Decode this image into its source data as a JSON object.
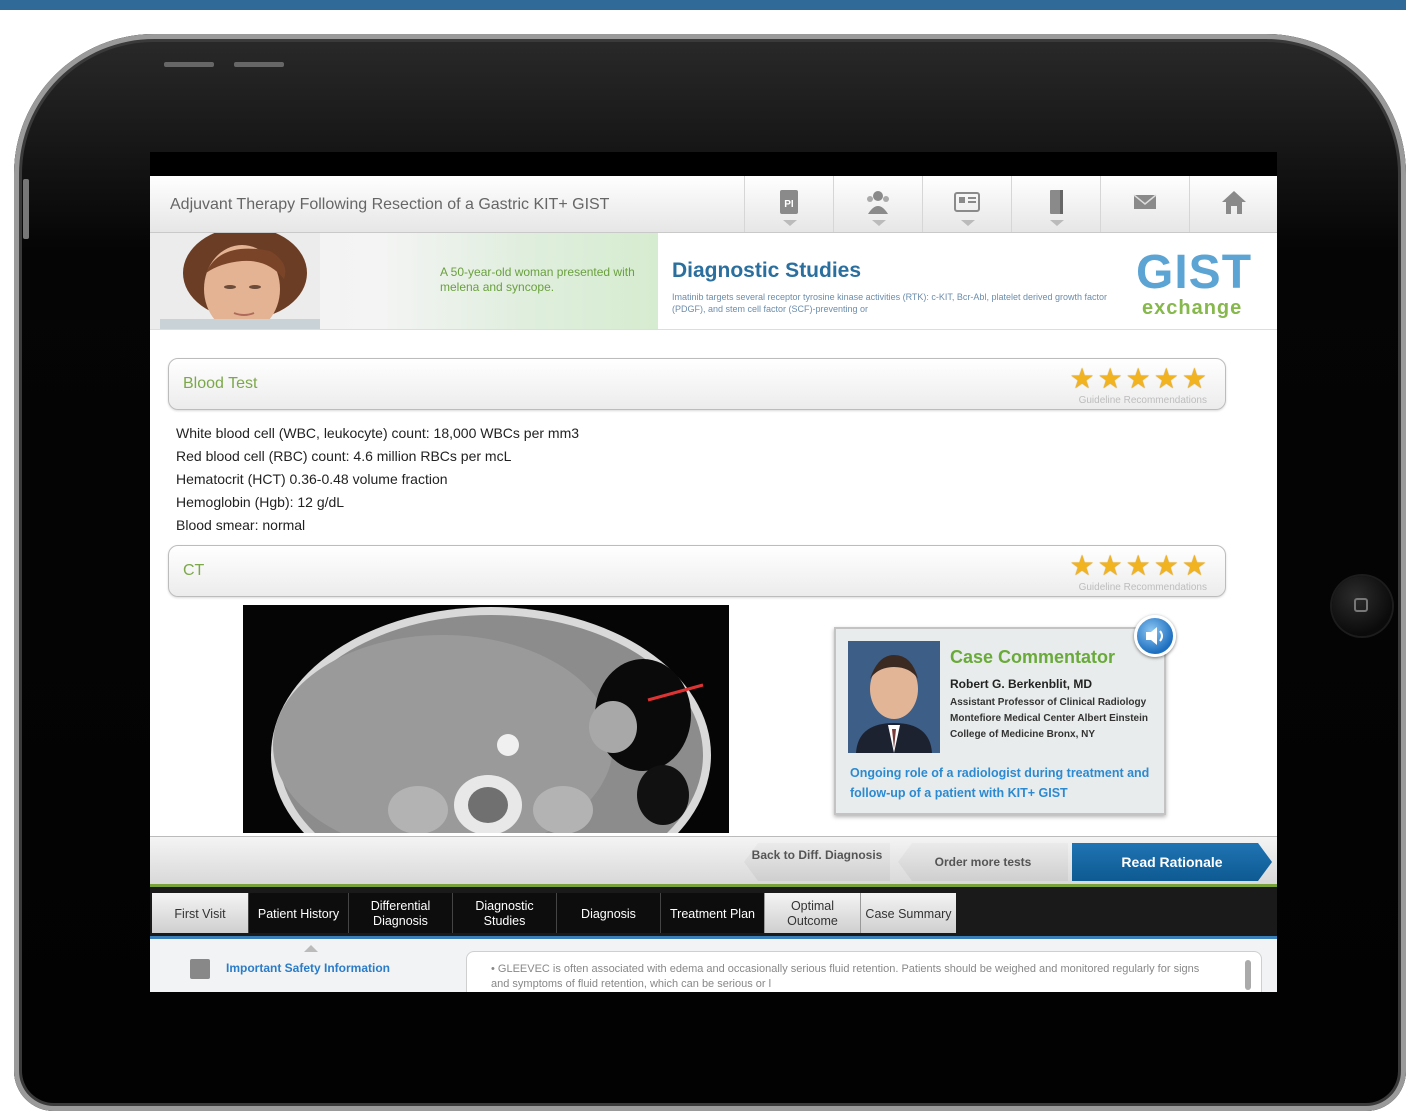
{
  "header": {
    "title": "Adjuvant Therapy Following Resection of a Gastric KIT+ GIST",
    "icons": [
      "pi-document-icon",
      "people-icon",
      "id-card-icon",
      "book-icon",
      "mail-icon",
      "home-icon"
    ]
  },
  "banner": {
    "case_text": "A 50-year-old woman presented with melena and syncope.",
    "section_title": "Diagnostic Studies",
    "section_desc": "Imatinib targets several receptor tyrosine kinase activities (RTK): c-KIT, Bcr-Abl, platelet derived growth factor (PDGF), and stem cell factor (SCF)-preventing or",
    "logo_main": "GIST",
    "logo_sub": "exchange"
  },
  "sections": {
    "blood_test": {
      "title": "Blood Test",
      "rating": 5,
      "rating_label": "Guideline Recommendations"
    },
    "ct": {
      "title": "CT",
      "rating": 5,
      "rating_label": "Guideline Recommendations"
    }
  },
  "blood_results": [
    "White blood cell (WBC, leukocyte) count: 18,000 WBCs per mm3",
    "Red blood cell (RBC) count: 4.6 million RBCs per mcL",
    "Hematocrit (HCT) 0.36-0.48 volume fraction",
    "Hemoglobin (Hgb): 12 g/dL",
    "Blood smear: normal"
  ],
  "commentator": {
    "title": "Case Commentator",
    "name": "Robert G. Berkenblit, MD",
    "affiliation": "Assistant Professor of Clinical Radiology Montefiore Medical Center Albert Einstein College of Medicine Bronx, NY",
    "topic": "Ongoing role of a radiologist during treatment and follow-up of a patient with KIT+ GIST"
  },
  "actions": {
    "back": "Back to Diff. Diagnosis",
    "order": "Order more tests",
    "read": "Read Rationale"
  },
  "tabs": [
    {
      "label": "First Visit",
      "style": "active"
    },
    {
      "label": "Patient History",
      "style": "dark"
    },
    {
      "label": "Differential Diagnosis",
      "style": "dark"
    },
    {
      "label": "Diagnostic Studies",
      "style": "dark"
    },
    {
      "label": "Diagnosis",
      "style": "dark"
    },
    {
      "label": "Treatment Plan",
      "style": "dark"
    },
    {
      "label": "Optimal Outcome",
      "style": "light"
    },
    {
      "label": "Case Summary",
      "style": "light"
    }
  ],
  "footer": {
    "isi_label": "Important Safety Information",
    "isi_text": "• GLEEVEC is often associated with edema and occasionally serious fluid retention. Patients should be weighed and monitored regularly for signs and symptoms of fluid retention, which can be serious or l"
  },
  "colors": {
    "accent_blue": "#2a6f9e",
    "accent_green": "#7ca84a",
    "star": "#f2b320",
    "read_button": "#1f74b3"
  }
}
